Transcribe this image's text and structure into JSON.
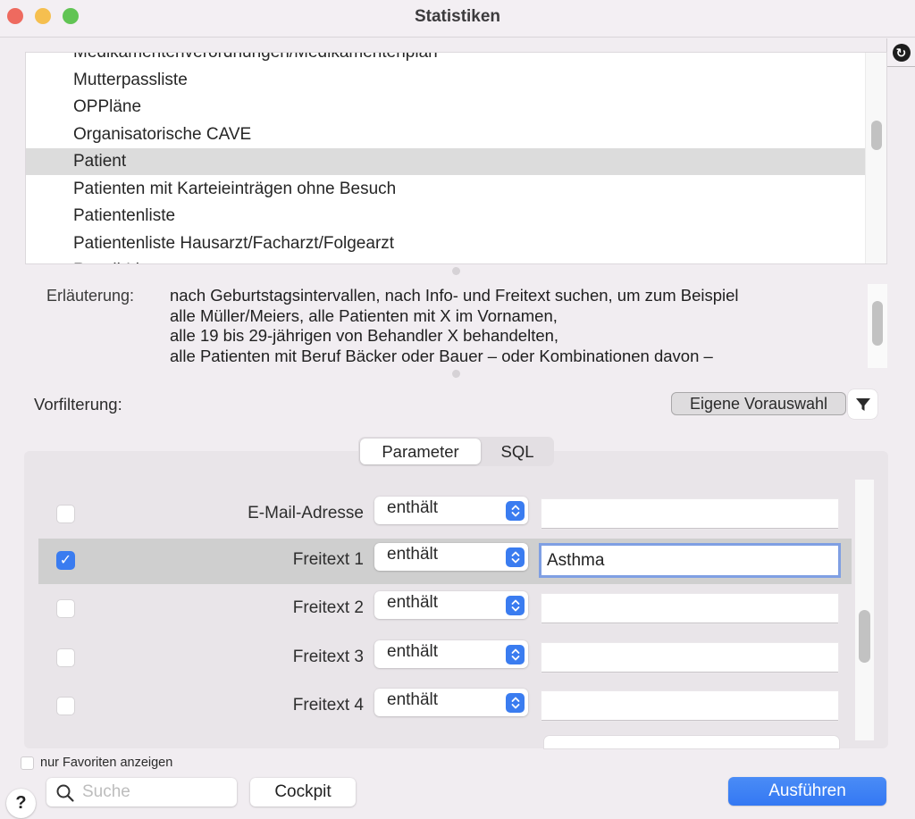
{
  "window": {
    "title": "Statistiken"
  },
  "icons": {
    "refresh": "refresh-icon",
    "filter": "filter-icon",
    "search": "search-icon",
    "help": "?",
    "check": "✓",
    "refresh_glyph": "↻"
  },
  "statistics_list": {
    "items": [
      {
        "label": "Medikamentenverordnungen/Medikamentenplan",
        "selected": false,
        "partial": true
      },
      {
        "label": "Mutterpassliste",
        "selected": false
      },
      {
        "label": "OPPläne",
        "selected": false
      },
      {
        "label": "Organisatorische CAVE",
        "selected": false
      },
      {
        "label": "Patient",
        "selected": true
      },
      {
        "label": "Patienten mit Karteieinträgen ohne Besuch",
        "selected": false
      },
      {
        "label": "Patientenliste",
        "selected": false
      },
      {
        "label": "Patientenliste Hausarzt/Facharzt/Folgearzt",
        "selected": false
      },
      {
        "label": "Recall-Liste",
        "selected": false,
        "partial": true
      }
    ]
  },
  "explanation": {
    "label": "Erläuterung:",
    "lines": [
      "nach Geburtstagsintervallen, nach Info- und Freitext suchen, um zum Beispiel",
      "alle Müller/Meiers, alle Patienten mit X im Vornamen,",
      "alle 19 bis 29-jährigen von Behandler X behandelten,",
      "alle Patienten mit Beruf Bäcker oder Bauer – oder Kombinationen davon –"
    ]
  },
  "prefilter": {
    "label": "Vorfilterung:",
    "own_selection_button": "Eigene Vorauswahl"
  },
  "tabs": [
    {
      "label": "Parameter",
      "active": true
    },
    {
      "label": "SQL",
      "active": false
    }
  ],
  "parameters": [
    {
      "label": "E-Mail-Adresse",
      "checked": false,
      "operator": "enthält",
      "value": "",
      "selected": false
    },
    {
      "label": "Freitext 1",
      "checked": true,
      "operator": "enthält",
      "value": "Asthma",
      "selected": true
    },
    {
      "label": "Freitext 2",
      "checked": false,
      "operator": "enthält",
      "value": "",
      "selected": false
    },
    {
      "label": "Freitext 3",
      "checked": false,
      "operator": "enthält",
      "value": "",
      "selected": false
    },
    {
      "label": "Freitext 4",
      "checked": false,
      "operator": "enthält",
      "value": "",
      "selected": false
    }
  ],
  "footer": {
    "favorites_only_label": "nur Favoriten anzeigen",
    "favorites_only_checked": false,
    "search_placeholder": "Suche",
    "search_value": "",
    "cockpit_button": "Cockpit",
    "run_button": "Ausführen",
    "help_button": "?"
  },
  "colors": {
    "accent": "#3a7cf0",
    "selection_row": "#dcdcdc",
    "focus_ring": "#7f9fe3"
  }
}
